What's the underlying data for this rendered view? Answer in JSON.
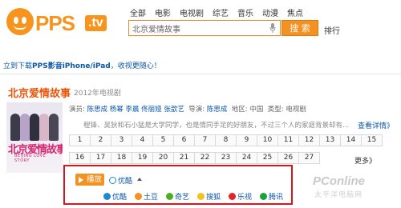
{
  "logo": {
    "text": "PPS",
    "tv": ".tv"
  },
  "nav": [
    "全部",
    "电影",
    "电视剧",
    "综艺",
    "音乐",
    "动漫",
    "焦点"
  ],
  "search": {
    "value": "北京爱情故事",
    "button": "搜 索",
    "rank": "排行"
  },
  "promo": {
    "prefix": "立到下载",
    "brand": "PPS影音iPhone/iPad",
    "suffix": "，收视更随心！"
  },
  "show": {
    "title": "北京爱情故事",
    "meta": "2012年电视剧",
    "poster_title": "北京爱情故事",
    "poster_subtitle": "BEIJING LOVE STORY",
    "credits": {
      "actors_label": "演员:",
      "actors": "陈思成 杨幂 李晨 佟丽娅 张歆艺",
      "director_label": "导演:",
      "director": "陈思成",
      "region_label": "地区:",
      "region": "中国",
      "type_label": "类型:",
      "type": "电视剧"
    },
    "synopsis": "程锋、吴狄和石小猛是大学同学，也是情同手足的好朋友，不过三个人的家庭背景却有...",
    "detail_link": "查看详情》",
    "episodes_row1": [
      "1",
      "2",
      "3",
      "4",
      "5",
      "6",
      "7",
      "8",
      "9",
      "10",
      "11",
      "12",
      "13",
      "14",
      "15"
    ],
    "episodes_row2": [
      "16",
      "17",
      "18",
      "19",
      "20",
      "21",
      "22",
      "23",
      "24",
      "25",
      "26",
      "27"
    ],
    "more": "更多》"
  },
  "player": {
    "play_label": "播放",
    "current_source": "优酷",
    "sources": [
      {
        "label": "优酷",
        "color": "#1e88d4"
      },
      {
        "label": "土豆",
        "color": "#f39121"
      },
      {
        "label": "奇艺",
        "color": "#4caf20"
      },
      {
        "label": "搜狐",
        "color": "#f2c318"
      },
      {
        "label": "乐视",
        "color": "#e0242a"
      },
      {
        "label": "腾讯",
        "color": "#1aa33a"
      }
    ]
  },
  "watermark": {
    "brand": "PConline",
    "sub": "太平洋电脑网"
  }
}
